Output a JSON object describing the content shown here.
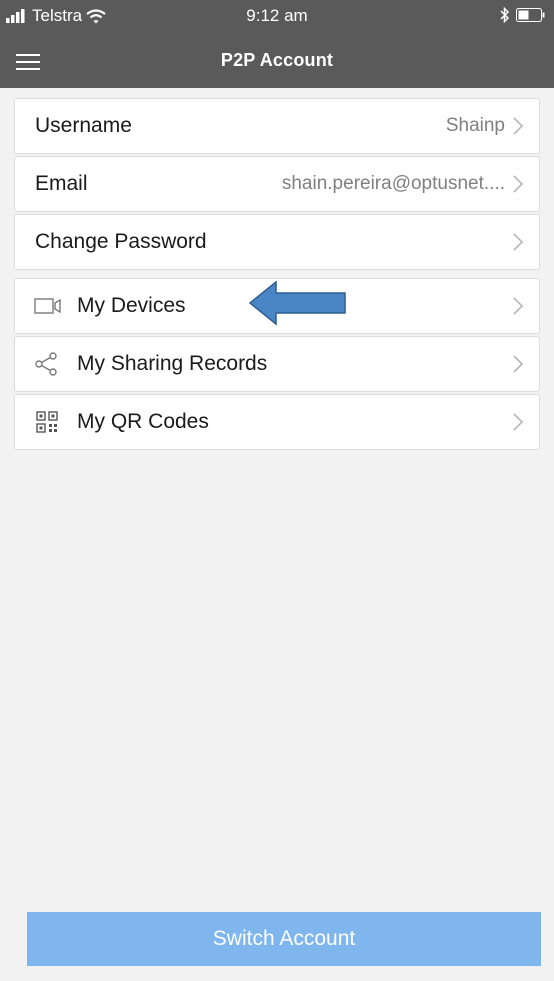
{
  "status_bar": {
    "carrier": "Telstra",
    "time": "9:12 am",
    "icons": [
      "signal-icon",
      "wifi-icon",
      "bluetooth-icon",
      "battery-icon"
    ]
  },
  "nav": {
    "title": "P2P Account",
    "menu_icon": "hamburger-menu-icon"
  },
  "account_rows": [
    {
      "label": "Username",
      "value": "Shainp"
    },
    {
      "label": "Email",
      "value": "shain.pereira@optusnet...."
    },
    {
      "label": "Change Password",
      "value": ""
    }
  ],
  "menu_rows": [
    {
      "label": "My Devices",
      "icon": "camera-icon"
    },
    {
      "label": "My Sharing Records",
      "icon": "share-icon"
    },
    {
      "label": "My QR Codes",
      "icon": "qr-code-icon"
    }
  ],
  "annotation": {
    "icon": "blue-arrow-left-icon",
    "color": "#4a86c5"
  },
  "footer": {
    "switch_account_label": "Switch Account"
  },
  "colors": {
    "header": "#5a5a5a",
    "background": "#f2f2f2",
    "button": "#7fb6ee",
    "icon_stroke": "#7a7a7a"
  }
}
